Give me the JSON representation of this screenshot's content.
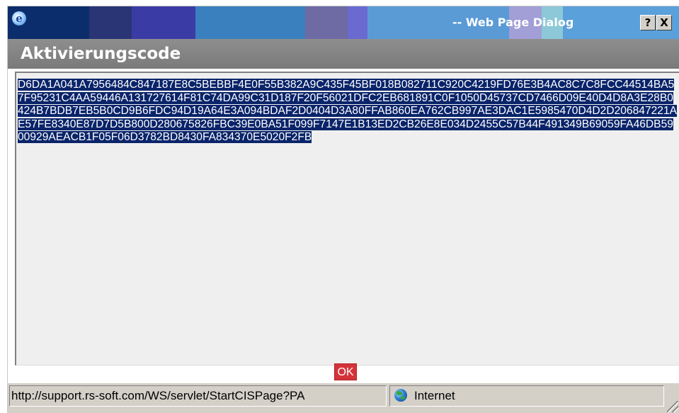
{
  "window": {
    "title": "-- Web Page Dialog",
    "help_button": "?",
    "close_button": "X"
  },
  "dialog": {
    "heading": "Aktivierungscode",
    "code": "D6DA1A041A7956484C847187E8C5BEBBF4E0F55B382A9C435F45BF018B082711C920C4219FD76E3B4AC8C7C8FCC44514BA57F95231C4AA59446A131727614F81C74DA99C31D187F20F56021DFC2EB681891C0F1050D45737CD7466D09E40D4D8A3E28B0424B7BDB7EB5B0CD9B6FDC94D19A64E3A094BDAF2D0404D3A80FFAB860EA762CB997AE3DAC1E5985470D4D2D206847221AE57FE8340E87D7D5B800D280675826FBC39E0BA51F099F7147E1B13ED2CB26E8E034D2455C57B44F491349B69059FA46DB5900929AEACB1F05F06D3782BD8430FA834370E5020F2FB",
    "ok_label": "OK"
  },
  "statusbar": {
    "url": "http://support.rs-soft.com/WS/servlet/StartCISPage?PA",
    "zone": "Internet"
  },
  "colors": {
    "selection": "#0a246a",
    "heading_bg": "#888888",
    "ok_button": "#d5333a",
    "chrome": "#d4d0c8"
  },
  "icons": {
    "app": "ie-logo-icon",
    "zone": "globe-icon",
    "resize": "resize-grip-icon"
  }
}
